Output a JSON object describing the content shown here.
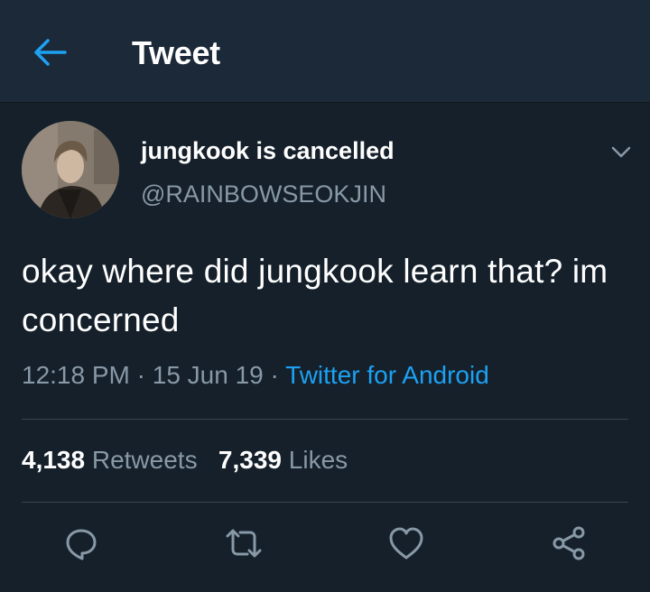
{
  "header": {
    "title": "Tweet",
    "back_icon": "arrow-left-icon",
    "accent_color": "#1da1f2"
  },
  "tweet": {
    "display_name": "jungkook is cancelled",
    "handle": "@RAINBOWSEOKJIN",
    "text": "okay where did jungkook learn that? im concerned",
    "time": "12:18 PM",
    "separator": " · ",
    "date": "15 Jun 19",
    "source": "Twitter for Android"
  },
  "stats": {
    "retweets_count": "4,138",
    "retweets_label": "Retweets",
    "likes_count": "7,339",
    "likes_label": "Likes"
  },
  "actions": [
    "reply-icon",
    "retweet-icon",
    "like-icon",
    "share-icon"
  ]
}
